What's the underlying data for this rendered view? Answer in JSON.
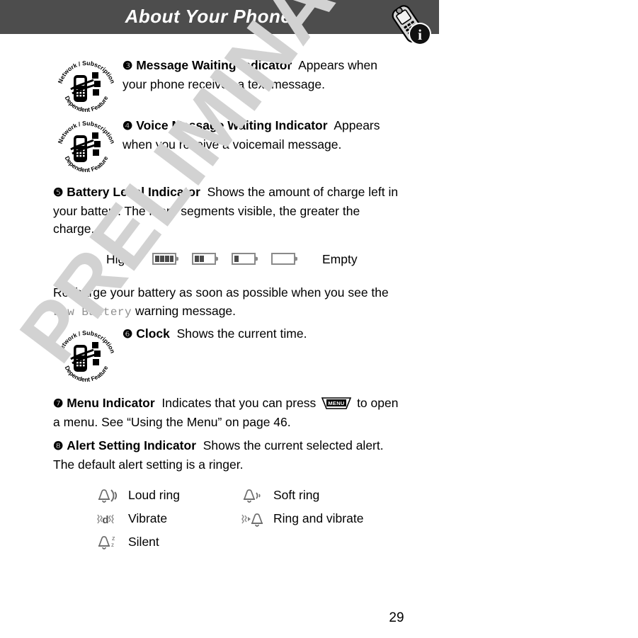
{
  "header": {
    "title": "About Your Phone",
    "phone_icon": "phone-info-icon",
    "band_color": "#4d4d4d",
    "title_color": "#ffffff"
  },
  "watermark": {
    "text": "PRELIMINARY",
    "color": "#d2d2d2"
  },
  "badge": {
    "top_arc_text": "Network / Subscription",
    "bottom_arc_text": "Dependent Feature",
    "icon": "network-subscription-dependent-feature-badge"
  },
  "items": [
    {
      "number": "❸",
      "title": "Message Waiting Indicator",
      "body": "Appears when your phone receives a text message.",
      "has_badge": true
    },
    {
      "number": "❹",
      "title": "Voice Message Waiting Indicator",
      "body": "Appears when you receive a voicemail message.",
      "has_badge": true
    },
    {
      "number": "❺",
      "title": "Battery Level Indicator",
      "body": "Shows the amount of charge left in your battery. The more segments visible, the greater the charge.",
      "has_badge": false
    },
    {
      "number": "❻",
      "title": "Clock",
      "body": "Shows the current time.",
      "has_badge": true
    },
    {
      "number": "❼",
      "title": "Menu Indicator",
      "body_before_key": "Indicates that you can press",
      "key_label": "MENU",
      "body_after_key": "to open a menu. See “Using the Menu” on page 46.",
      "has_badge": false
    },
    {
      "number": "❽",
      "title": "Alert Setting Indicator",
      "body": "Shows the current selected alert. The default alert setting is a ringer.",
      "has_badge": false
    }
  ],
  "recharge_note": {
    "before": "Recharge your battery as soon as possible when you see the",
    "code": "Low Battery",
    "after": "warning message."
  },
  "battery_scale": {
    "high_label": "High",
    "empty_label": "Empty",
    "levels": [
      4,
      2,
      1,
      0
    ],
    "icon_name": "battery-level-icon"
  },
  "alert_settings": [
    {
      "icon": "loud-ring-icon",
      "label": "Loud ring"
    },
    {
      "icon": "soft-ring-icon",
      "label": "Soft ring"
    },
    {
      "icon": "vibrate-icon",
      "label": "Vibrate"
    },
    {
      "icon": "ring-and-vibrate-icon",
      "label": "Ring and vibrate"
    },
    {
      "icon": "silent-icon",
      "label": "Silent"
    }
  ],
  "footer": {
    "page_number": "29"
  }
}
